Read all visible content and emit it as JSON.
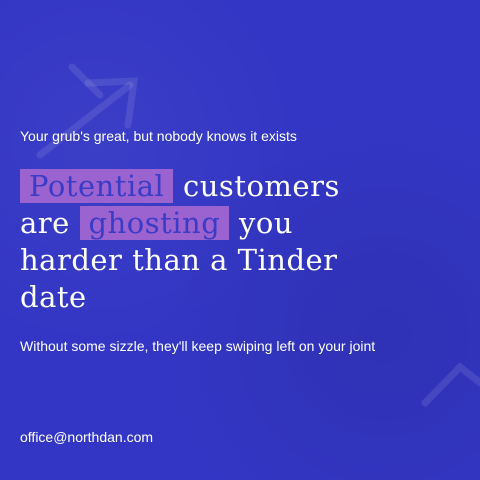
{
  "kicker": "Your grub's great, but nobody knows it exists",
  "headline": {
    "line1_highlight": "Potential",
    "line1_rest": "customers",
    "line2_start": "are",
    "line2_highlight": "ghosting",
    "line2_end": "you",
    "line3": "harder than a Tinder",
    "line4": "date"
  },
  "subtext": "Without some sizzle, they'll keep swiping left on your joint",
  "email": "office@northdan.com",
  "colors": {
    "background": "#3336c4",
    "highlight": "#9b63cf",
    "text": "#ffffff"
  },
  "decorations": [
    "arrow-up-right-icon",
    "chevron-up-icon"
  ]
}
